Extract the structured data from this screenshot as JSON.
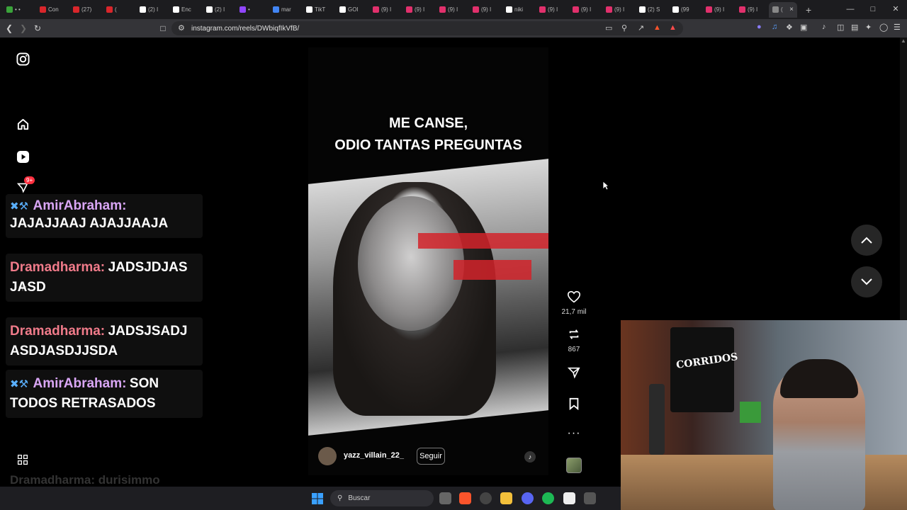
{
  "browser": {
    "tabs": [
      {
        "label": "• •",
        "color": "#3aa33a"
      },
      {
        "label": "Con",
        "color": "#d9262b"
      },
      {
        "label": "(27)",
        "color": "#d9262b"
      },
      {
        "label": "(",
        "color": "#d9262b"
      },
      {
        "label": "(2) I",
        "color": "#ffffff"
      },
      {
        "label": "Enc",
        "color": "#ffffff"
      },
      {
        "label": "(2) I",
        "color": "#ffffff"
      },
      {
        "label": "•",
        "color": "#9146ff"
      },
      {
        "label": "mar",
        "color": "#4285f4"
      },
      {
        "label": "TikT",
        "color": "#ffffff"
      },
      {
        "label": "GOI",
        "color": "#ffffff"
      },
      {
        "label": "(9) I",
        "color": "#e1306c"
      },
      {
        "label": "(9) I",
        "color": "#e1306c"
      },
      {
        "label": "(9) I",
        "color": "#e1306c"
      },
      {
        "label": "(9) I",
        "color": "#e1306c"
      },
      {
        "label": "niki",
        "color": "#ffffff"
      },
      {
        "label": "(9) I",
        "color": "#e1306c"
      },
      {
        "label": "(9) I",
        "color": "#e1306c"
      },
      {
        "label": "(9) I",
        "color": "#e1306c"
      },
      {
        "label": "(2) S",
        "color": "#ffffff"
      },
      {
        "label": "(99",
        "color": "#ffffff"
      },
      {
        "label": "(9) I",
        "color": "#e1306c"
      },
      {
        "label": "(9) I",
        "color": "#e1306c"
      }
    ],
    "active_tab": {
      "label": "(",
      "close": "×"
    },
    "new_tab": "+",
    "url": "instagram.com/reels/DWbiqfIkVfB/"
  },
  "chat": [
    {
      "user": "AmirAbraham:",
      "user_color": "#d9a6f5",
      "text": "JAJAJJAAJ AJAJJAAJA",
      "badges": "✖⚒"
    },
    {
      "user": "Dramadharma:",
      "user_color": "#f07b8a",
      "text": "JADSJDJAS JASD",
      "badges": ""
    },
    {
      "user": "Dramadharma:",
      "user_color": "#f07b8a",
      "text": "JADSJSADJ ASDJASDJJSDA",
      "badges": ""
    },
    {
      "user": "AmirAbraham:",
      "user_color": "#d9a6f5",
      "text": "SON TODOS RETRASADOS",
      "badges": "✖⚒"
    }
  ],
  "chat_fade": "Dramadharma: durisimmo",
  "notification_badge": "9+",
  "reel": {
    "caption_line1": "ME CANSE,",
    "caption_line2": "ODIO TANTAS PREGUNTAS",
    "username": "yazz_villain_22_",
    "follow_label": "Seguir",
    "likes": "21,7 mil",
    "reposts": "867"
  },
  "webcam": {
    "poster_text": "CORRIDOS"
  },
  "taskbar": {
    "search_placeholder": "Buscar"
  }
}
